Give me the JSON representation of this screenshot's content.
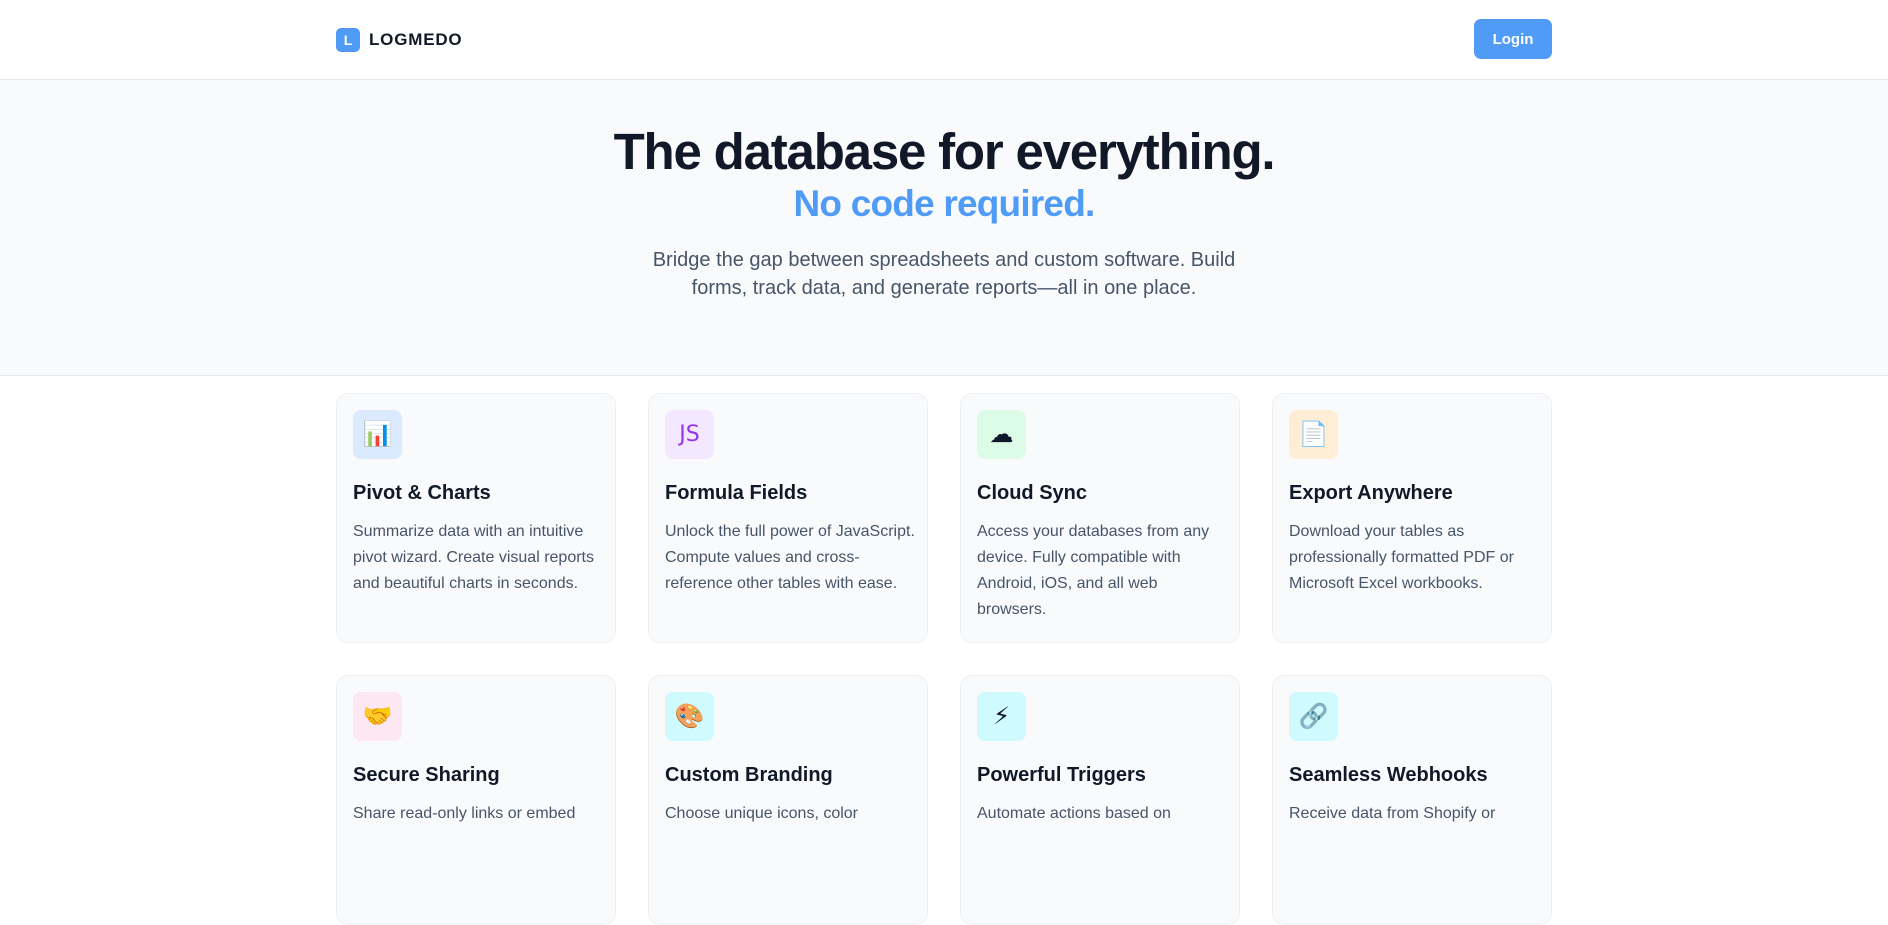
{
  "header": {
    "logo_letter": "L",
    "logo_text": "LOGMEDO",
    "login_label": "Login"
  },
  "hero": {
    "title": "The database for everything.",
    "subtitle": "No code required.",
    "description": "Bridge the gap between spreadsheets and custom software. Build forms, track data, and generate reports—all in one place."
  },
  "features": [
    {
      "icon": "bar-chart-icon",
      "glyph": "📊",
      "title": "Pivot & Charts",
      "text": "Summarize data with an intuitive pivot wizard. Create visual reports and beautiful charts in seconds.",
      "bg": "#dbeafe"
    },
    {
      "icon": "js-icon",
      "glyph": "JS",
      "title": "Formula Fields",
      "text": "Unlock the full power of JavaScript. Compute values and cross-reference other tables with ease.",
      "bg": "#f3e8ff"
    },
    {
      "icon": "cloud-icon",
      "glyph": "☁",
      "title": "Cloud Sync",
      "text": "Access your databases from any device. Fully compatible with Android, iOS, and all web browsers.",
      "bg": "#dcfce7"
    },
    {
      "icon": "document-icon",
      "glyph": "📄",
      "title": "Export Anywhere",
      "text": "Download your tables as professionally formatted PDF or Microsoft Excel workbooks.",
      "bg": "#ffedd5"
    },
    {
      "icon": "handshake-icon",
      "glyph": "🤝",
      "title": "Secure Sharing",
      "text": "Share read-only links or embed",
      "bg": "#fce7f3"
    },
    {
      "icon": "palette-icon",
      "glyph": "🎨",
      "title": "Custom Branding",
      "text": "Choose unique icons, color",
      "bg": "#cffafe"
    },
    {
      "icon": "lightning-icon",
      "glyph": "⚡",
      "title": "Powerful Triggers",
      "text": "Automate actions based on",
      "bg": "#cffafe"
    },
    {
      "icon": "link-icon",
      "glyph": "🔗",
      "title": "Seamless Webhooks",
      "text": "Receive data from Shopify or",
      "bg": "#cffafe"
    }
  ]
}
